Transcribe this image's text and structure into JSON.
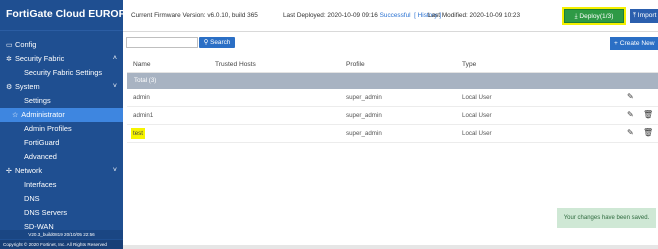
{
  "app": {
    "title": "FortiGate Cloud EUROPE"
  },
  "sidebar": {
    "items": [
      {
        "label": "Config",
        "icon": "monitor-icon",
        "level": "top"
      },
      {
        "label": "Security Fabric",
        "icon": "fabric-icon",
        "level": "top",
        "chevron": "˄"
      },
      {
        "label": "Security Fabric Settings",
        "level": "sub"
      },
      {
        "label": "System",
        "icon": "system-icon",
        "level": "top",
        "chevron": "˅"
      },
      {
        "label": "Settings",
        "level": "sub"
      },
      {
        "label": "Administrator",
        "level": "sub",
        "active": true
      },
      {
        "label": "Admin Profiles",
        "level": "sub"
      },
      {
        "label": "FortiGuard",
        "level": "sub"
      },
      {
        "label": "Advanced",
        "level": "sub"
      },
      {
        "label": "Network",
        "icon": "network-icon",
        "level": "top",
        "chevron": "˅"
      },
      {
        "label": "Interfaces",
        "level": "sub"
      },
      {
        "label": "DNS",
        "level": "sub"
      },
      {
        "label": "DNS Servers",
        "level": "sub"
      },
      {
        "label": "SD-WAN",
        "level": "sub"
      }
    ],
    "version": "V20.3_build0819 20/10/05 22:56",
    "copyright": "Copyright © 2020 Fortinet, Inc. All Rights Reserved"
  },
  "topbar": {
    "firmware_label": "Current Firmware Version: v6.0.10, build 365",
    "last_deployed_label": "Last Deployed: 2020-10-09 09:16",
    "deploy_status": "Successful",
    "history_link": "[ History ]",
    "last_modified_label": "Last Modified: 2020-10-09 10:23",
    "deploy_button": "Deploy(1/3)",
    "import_button": "Import"
  },
  "toolbar": {
    "search_placeholder": "",
    "search_button": "Search",
    "create_button": "Create New"
  },
  "table": {
    "columns": [
      "Name",
      "Trusted Hosts",
      "Profile",
      "Type"
    ],
    "group_label": "Total (3)",
    "rows": [
      {
        "name": "admin",
        "trusted_hosts": "",
        "profile": "super_admin",
        "type": "Local User",
        "deletable": false,
        "highlight": false
      },
      {
        "name": "admin1",
        "trusted_hosts": "",
        "profile": "super_admin",
        "type": "Local User",
        "deletable": true,
        "highlight": false
      },
      {
        "name": "test",
        "trusted_hosts": "",
        "profile": "super_admin",
        "type": "Local User",
        "deletable": true,
        "highlight": true
      }
    ]
  },
  "toast": {
    "message": "Your changes have been saved."
  },
  "colors": {
    "sidebar_bg": "#1f4f91",
    "sidebar_active": "#3e86e0",
    "deploy_green": "#2e9a46",
    "primary_blue": "#2b6fc5",
    "highlight_yellow": "#f6f400",
    "toast_bg": "#cfe8d5"
  }
}
